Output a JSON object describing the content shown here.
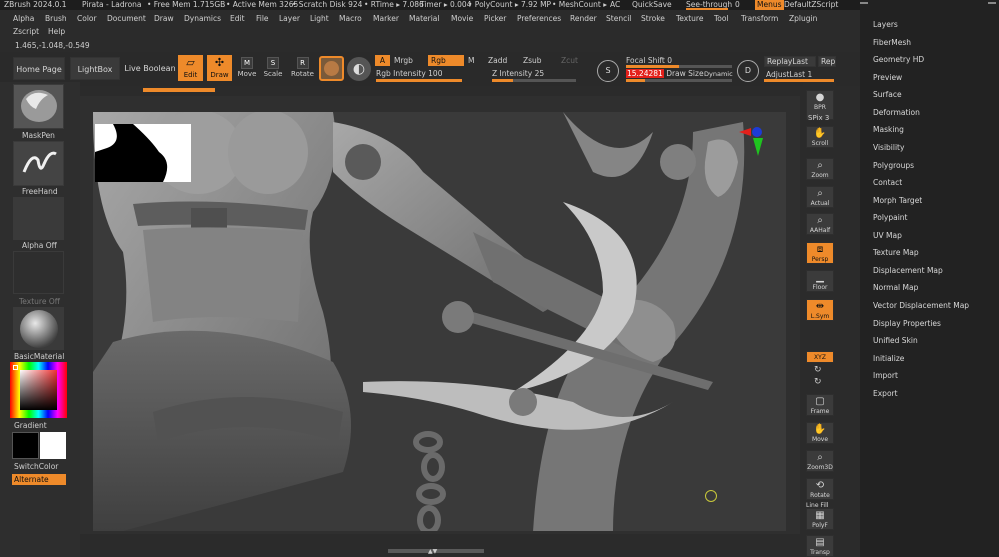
{
  "titlebar": {
    "app": "ZBrush 2024.0.1",
    "document": "Pirata - Ladrona",
    "free_mem": "• Free Mem 1.715GB",
    "active_mem": "• Active Mem 3265",
    "scratch": "• Scratch Disk 924",
    "rtime": "• RTime ▸ 7.086",
    "timer": "Timer ▸ 0.004",
    "polycount": "• PolyCount ▸ 7.92 MP",
    "meshcount": "• MeshCount ▸",
    "ac": "AC",
    "quicksave": "QuickSave",
    "see_through": "See-through",
    "see_through_value": "0",
    "menus": "Menus",
    "default_script": "DefaultZScript"
  },
  "menubar": [
    "Alpha",
    "Brush",
    "Color",
    "Document",
    "Draw",
    "Dynamics",
    "Edit",
    "File",
    "Layer",
    "Light",
    "Macro",
    "Marker",
    "Material",
    "Movie",
    "Picker",
    "Preferences",
    "Render",
    "Stencil",
    "Stroke",
    "Texture",
    "Tool",
    "Transform",
    "Zplugin"
  ],
  "menubar2": [
    "Zscript",
    "Help"
  ],
  "coordinates": "1.465,-1.048,-0.549",
  "top_shelf": {
    "home_page": "Home Page",
    "lightbox": "LightBox",
    "live_boolean": "Live Boolean",
    "edit": "Edit",
    "draw": "Draw",
    "move": "Move",
    "scale": "Scale",
    "rotate": "Rotate",
    "a": "A",
    "mrgb": "Mrgb",
    "rgb": "Rgb",
    "m": "M",
    "zadd": "Zadd",
    "zsub": "Zsub",
    "zcut": "Zcut",
    "rgb_intensity_label": "Rgb Intensity",
    "rgb_intensity": "100",
    "rgb_intensity_fill": 1.0,
    "z_intensity_label": "Z Intensity",
    "z_intensity": "25",
    "z_intensity_fill": 0.25,
    "focal_shift_label": "Focal Shift",
    "focal_shift": "0",
    "draw_size_label": "Draw Size",
    "draw_size": "15.24281",
    "dynamic": "Dynamic",
    "replay_last": "ReplayLast",
    "replay_cut": "Rep",
    "adjust_last": "AdjustLast",
    "adjust_last_value": "1"
  },
  "left_tray": {
    "brush": "MaskPen",
    "stroke": "FreeHand",
    "alpha": "Alpha Off",
    "texture": "Texture Off",
    "material": "BasicMaterial",
    "gradient": "Gradient",
    "switch_color": "SwitchColor",
    "alternate": "Alternate"
  },
  "right_tray": [
    "BPR",
    "SPix 3",
    "Scroll",
    "Zoom",
    "Actual",
    "AAHalf",
    "Persp",
    "Floor",
    "L.Sym",
    "XYZ",
    "Frame",
    "Move",
    "Zoom3D",
    "Rotate",
    "PolyF",
    "Transp"
  ],
  "right_tray_active": [
    "Persp",
    "L.Sym",
    "XYZ"
  ],
  "line_fill": "Line Fill",
  "palette": [
    "Layers",
    "FiberMesh",
    "Geometry HD",
    "Preview",
    "Surface",
    "Deformation",
    "Masking",
    "Visibility",
    "Polygroups",
    "Contact",
    "Morph Target",
    "Polypaint",
    "UV Map",
    "Texture Map",
    "Displacement Map",
    "Normal Map",
    "Vector Displacement Map",
    "Display Properties",
    "Unified Skin",
    "Initialize",
    "Import",
    "Export"
  ],
  "colors": {
    "accent": "#ee8a2a",
    "draw_size_red": "#e3201b",
    "background": "#2b2b2b",
    "mesh": "#8d8d8d"
  }
}
